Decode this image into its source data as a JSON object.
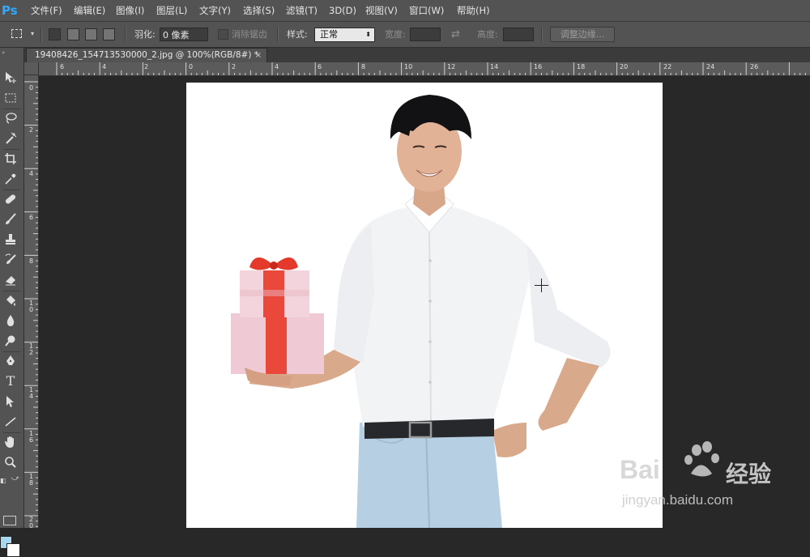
{
  "app": {
    "logo": "Ps"
  },
  "menu": [
    "文件(F)",
    "编辑(E)",
    "图像(I)",
    "图层(L)",
    "文字(Y)",
    "选择(S)",
    "滤镜(T)",
    "3D(D)",
    "视图(V)",
    "窗口(W)",
    "帮助(H)"
  ],
  "options": {
    "feather_label": "羽化:",
    "feather_value": "0 像素",
    "antialias_label": "消除锯齿",
    "style_label": "样式:",
    "style_value": "正常",
    "width_label": "宽度:",
    "height_label": "高度:",
    "refine_edge_button": "调整边缘..."
  },
  "document": {
    "tab_title": "19408426_154713530000_2.jpg @ 100%(RGB/8#) *",
    "tab_close": "×"
  },
  "rulers": {
    "top": [
      "6",
      "4",
      "2",
      "0",
      "2",
      "4",
      "6",
      "8",
      "10",
      "12",
      "14",
      "16",
      "18",
      "20",
      "22",
      "24",
      "26"
    ],
    "left": [
      "0",
      "2",
      "4",
      "6",
      "8",
      "10",
      "12",
      "14",
      "16",
      "18",
      "20"
    ]
  },
  "colors": {
    "foreground": "#a6d8f0",
    "background": "#ffffff",
    "accent": "#31a8ff"
  },
  "tools": [
    "move-tool-icon",
    "marquee-tool-icon",
    "lasso-tool-icon",
    "magic-wand-tool-icon",
    "crop-tool-icon",
    "eyedropper-tool-icon",
    "healing-brush-tool-icon",
    "brush-tool-icon",
    "clone-stamp-tool-icon",
    "history-brush-tool-icon",
    "eraser-tool-icon",
    "paint-bucket-tool-icon",
    "blur-tool-icon",
    "dodge-tool-icon",
    "pen-tool-icon",
    "type-tool-icon",
    "path-selection-tool-icon",
    "line-tool-icon",
    "hand-tool-icon",
    "zoom-tool-icon"
  ],
  "watermark": {
    "line1": "Bai",
    "line1b": "经验",
    "line2": "jingyan.baidu.com"
  }
}
